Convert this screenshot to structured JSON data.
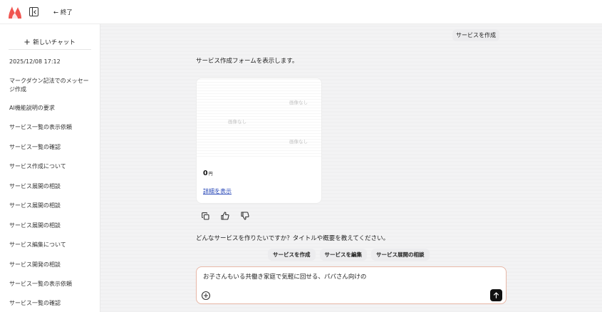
{
  "header": {
    "exit_label": "← 終了"
  },
  "sidebar": {
    "new_chat_label": "新しいチャット",
    "items": [
      {
        "label": "2025/12/08 17:12"
      },
      {
        "label": "マークダウン記法でのメッセージ作成"
      },
      {
        "label": "AI機能説明の要求"
      },
      {
        "label": "サービス一覧の表示依頼"
      },
      {
        "label": "サービス一覧の確認"
      },
      {
        "label": "サービス作成について"
      },
      {
        "label": "サービス展開の相談"
      },
      {
        "label": "サービス展開の相談"
      },
      {
        "label": "サービス展開の相談"
      },
      {
        "label": "サービス編集について"
      },
      {
        "label": "サービス開発の相談"
      },
      {
        "label": "サービス一覧の表示依頼"
      },
      {
        "label": "サービス一覧の確認"
      }
    ]
  },
  "chat": {
    "user_message": "サービスを作成",
    "assistant_intro": "サービス作成フォームを表示します。",
    "card": {
      "placeholders": [
        "画像なし",
        "画像なし",
        "画像なし"
      ],
      "price_value": "0",
      "price_unit": "円",
      "detail_link": "詳細を表示"
    },
    "question": "どんなサービスを作りたいですか？タイトルや概要を教えてください。",
    "suggestions": [
      {
        "label": "サービスを作成"
      },
      {
        "label": "サービスを編集"
      },
      {
        "label": "サービス展開の相談"
      }
    ]
  },
  "composer": {
    "value": "お子さんもいる共働き家庭で気軽に回せる、パパさん向けの"
  },
  "colors": {
    "brand": "#f0544f",
    "link": "#2a49b8",
    "composer_border": "#e7b7a6"
  },
  "icons": [
    "logo-icon",
    "sidebar-toggle-icon",
    "plus-icon",
    "copy-icon",
    "thumbs-up-icon",
    "thumbs-down-icon",
    "attach-icon",
    "send-icon"
  ]
}
